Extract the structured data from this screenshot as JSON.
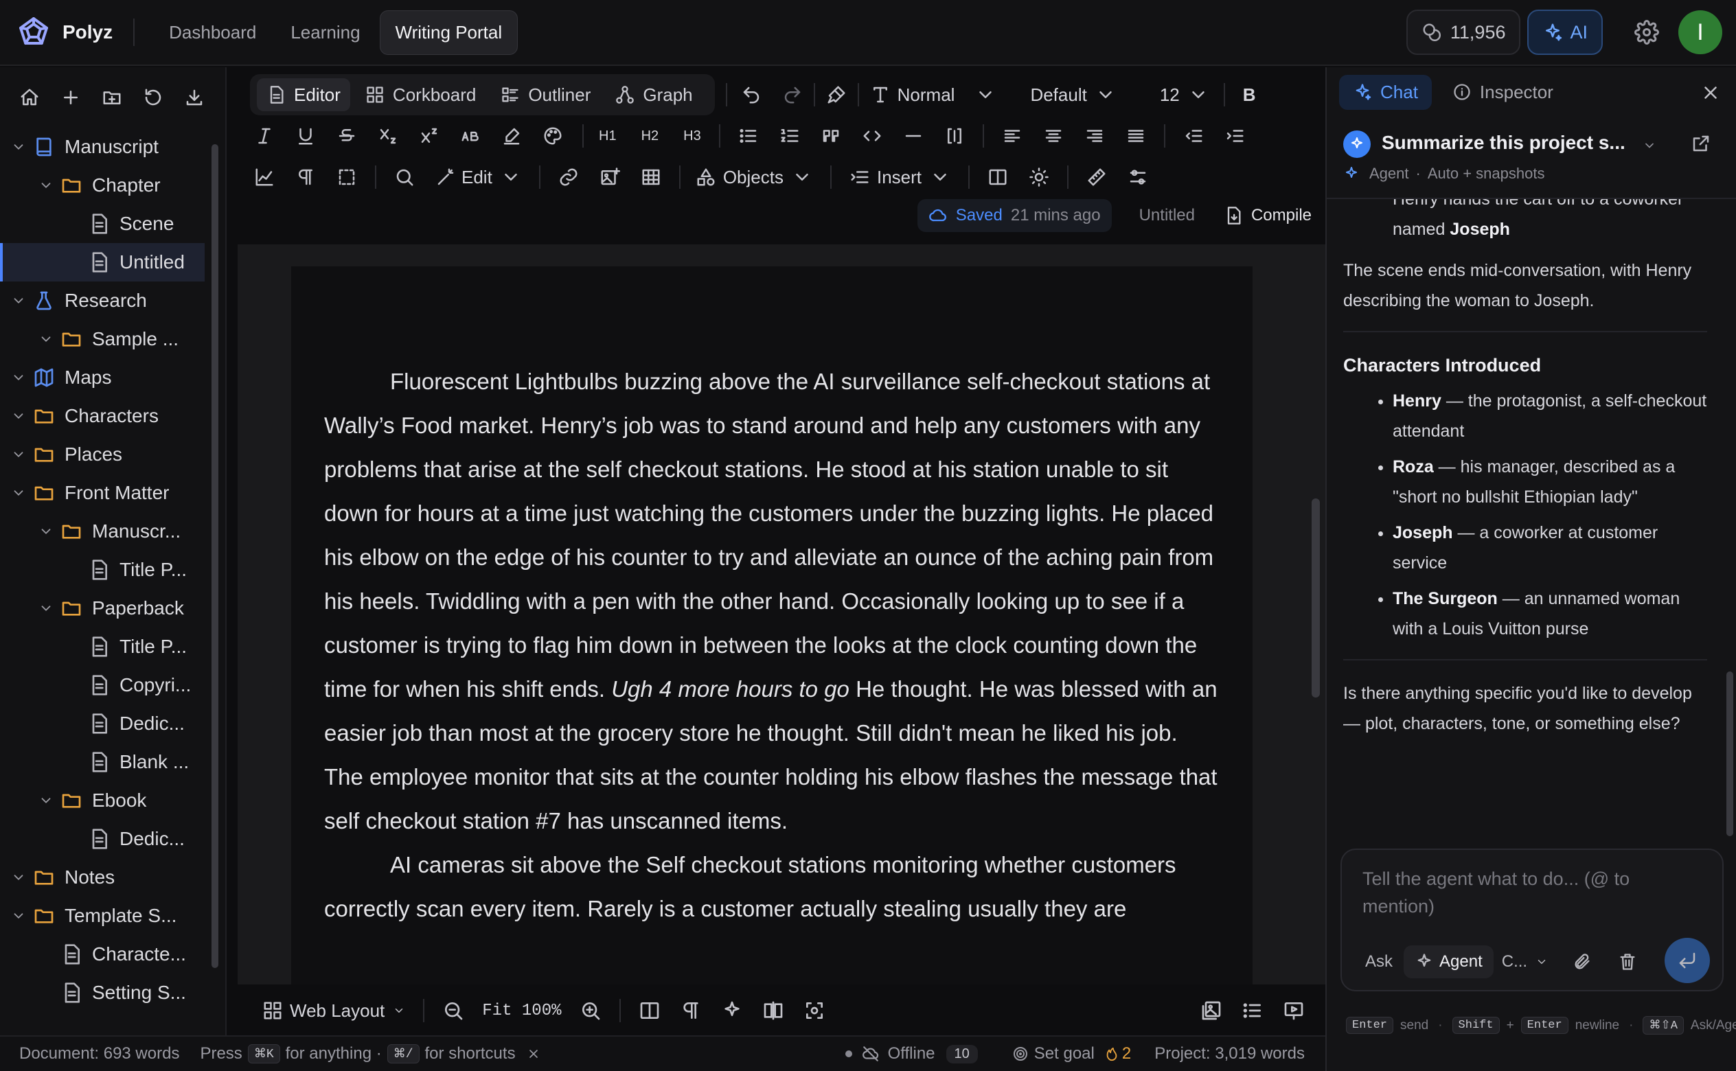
{
  "app": {
    "name": "Polyz"
  },
  "nav": {
    "tabs": [
      "Dashboard",
      "Learning",
      "Writing Portal"
    ],
    "active": "Writing Portal"
  },
  "topbar": {
    "credits": "11,956",
    "ai_label": "AI",
    "avatar_initial": "I",
    "accent_color": "#3b82f6"
  },
  "sidebar": {
    "tree": [
      {
        "label": "Manuscript",
        "depth": 0,
        "icon": "book-icon",
        "chevron": true
      },
      {
        "label": "Chapter",
        "depth": 1,
        "icon": "folder-icon",
        "chevron": true
      },
      {
        "label": "Scene",
        "depth": 2,
        "icon": "document-icon",
        "chevron": false
      },
      {
        "label": "Untitled",
        "depth": 2,
        "icon": "document-icon",
        "chevron": false,
        "selected": true
      },
      {
        "label": "Research",
        "depth": 0,
        "icon": "flask-icon",
        "chevron": true
      },
      {
        "label": "Sample ...",
        "depth": 1,
        "icon": "folder-icon",
        "chevron": true
      },
      {
        "label": "Maps",
        "depth": 0,
        "icon": "map-icon",
        "chevron": true
      },
      {
        "label": "Characters",
        "depth": 0,
        "icon": "folder-icon",
        "chevron": true
      },
      {
        "label": "Places",
        "depth": 0,
        "icon": "folder-icon",
        "chevron": true
      },
      {
        "label": "Front Matter",
        "depth": 0,
        "icon": "folder-icon",
        "chevron": true
      },
      {
        "label": "Manuscr...",
        "depth": 1,
        "icon": "folder-icon",
        "chevron": true
      },
      {
        "label": "Title P...",
        "depth": 2,
        "icon": "document-icon",
        "chevron": false
      },
      {
        "label": "Paperback",
        "depth": 1,
        "icon": "folder-icon",
        "chevron": true
      },
      {
        "label": "Title P...",
        "depth": 2,
        "icon": "document-icon",
        "chevron": false
      },
      {
        "label": "Copyri...",
        "depth": 2,
        "icon": "document-icon",
        "chevron": false
      },
      {
        "label": "Dedic...",
        "depth": 2,
        "icon": "document-icon",
        "chevron": false
      },
      {
        "label": "Blank ...",
        "depth": 2,
        "icon": "document-icon",
        "chevron": false
      },
      {
        "label": "Ebook",
        "depth": 1,
        "icon": "folder-icon",
        "chevron": true
      },
      {
        "label": "Dedic...",
        "depth": 2,
        "icon": "document-icon",
        "chevron": false
      },
      {
        "label": "Notes",
        "depth": 0,
        "icon": "folder-icon",
        "chevron": true
      },
      {
        "label": "Template S...",
        "depth": 0,
        "icon": "folder-icon",
        "chevron": true
      },
      {
        "label": "Characte...",
        "depth": 1,
        "icon": "document-icon",
        "chevron": false
      },
      {
        "label": "Setting S...",
        "depth": 1,
        "icon": "document-icon",
        "chevron": false
      }
    ]
  },
  "toolbar": {
    "view_tabs": [
      "Editor",
      "Corkboard",
      "Outliner",
      "Graph"
    ],
    "active_view": "Editor",
    "style": "Normal",
    "font": "Default",
    "size": "12",
    "bold": "B",
    "h1": "H1",
    "h2": "H2",
    "h3": "H3",
    "edit": "Edit",
    "objects": "Objects",
    "insert": "Insert"
  },
  "docstatus": {
    "saved": "Saved",
    "ago": "21 mins ago",
    "doc_title": "Untitled",
    "compile": "Compile"
  },
  "document": {
    "p1_a": "Fluorescent Lightbulbs buzzing above the AI surveillance self-checkout stations at Wally’s Food market. Henry’s job was to stand around and help any customers with any problems that arise at the self checkout stations. He stood at his station unable to sit down for hours at a time just watching the customers under the buzzing lights. He placed his elbow on the edge of his counter to try and alleviate an ounce of the aching pain from his heels. Twiddling with a pen with the other hand. Occasionally looking up to see if a customer is trying to flag him down in between the looks at the clock counting down the time for when his shift ends. ",
    "p1_em": "Ugh 4 more hours to go",
    "p1_b": " He thought. He was blessed with an easier job than most at the grocery store he thought. Still didn't mean he liked his job. The employee monitor that sits at the counter holding his elbow flashes the message that self checkout station #7 has unscanned items.",
    "p2": "AI cameras sit above the Self checkout stations monitoring whether customers correctly scan every item. Rarely is a customer actually stealing usually they are"
  },
  "bottombar": {
    "layout": "Web Layout",
    "zoom": "Fit 100%"
  },
  "statusbar": {
    "words": "Document: 693 words",
    "press": "Press",
    "k1": "⌘K",
    "for_anything": "for anything ·",
    "k2": "⌘/",
    "for_shortcuts": "for shortcuts",
    "offline": "Offline",
    "offline_count": "10",
    "goal": "Set goal",
    "streak": "2",
    "project_words": "Project: 3,019 words"
  },
  "panel": {
    "tabs": [
      "Chat",
      "Inspector"
    ],
    "active": "Chat",
    "thread_title": "Summarize this project s...",
    "mode": "Agent",
    "sub": "Auto + snapshots",
    "msg": {
      "cut_a": "Henry hands the cart off to a coworker named ",
      "cut_b": "Joseph",
      "ending": "The scene ends mid-conversation, with Henry describing the woman to Joseph.",
      "heading": "Characters Introduced",
      "chars": [
        {
          "name": "Henry",
          "desc": " — the protagonist, a self-checkout attendant"
        },
        {
          "name": "Roza",
          "desc": " — his manager, described as a \"short no bullshit Ethiopian lady\""
        },
        {
          "name": "Joseph",
          "desc": " — a coworker at customer service"
        },
        {
          "name": "The Surgeon",
          "desc": " — an unnamed woman with a Louis Vuitton purse"
        }
      ],
      "question": "Is there anything specific you'd like to develop — plot, characters, tone, or something else?"
    },
    "composer": {
      "placeholder": "Tell the agent what to do... (@ to mention)",
      "ask": "Ask",
      "agent": "Agent",
      "model": "C..."
    },
    "hints": {
      "enter": "Enter",
      "send": "send",
      "shift": "Shift",
      "plus": "+",
      "enter2": "Enter",
      "newline": "newline",
      "combo": "⌘⇧A",
      "askagent": "Ask/Age"
    }
  }
}
